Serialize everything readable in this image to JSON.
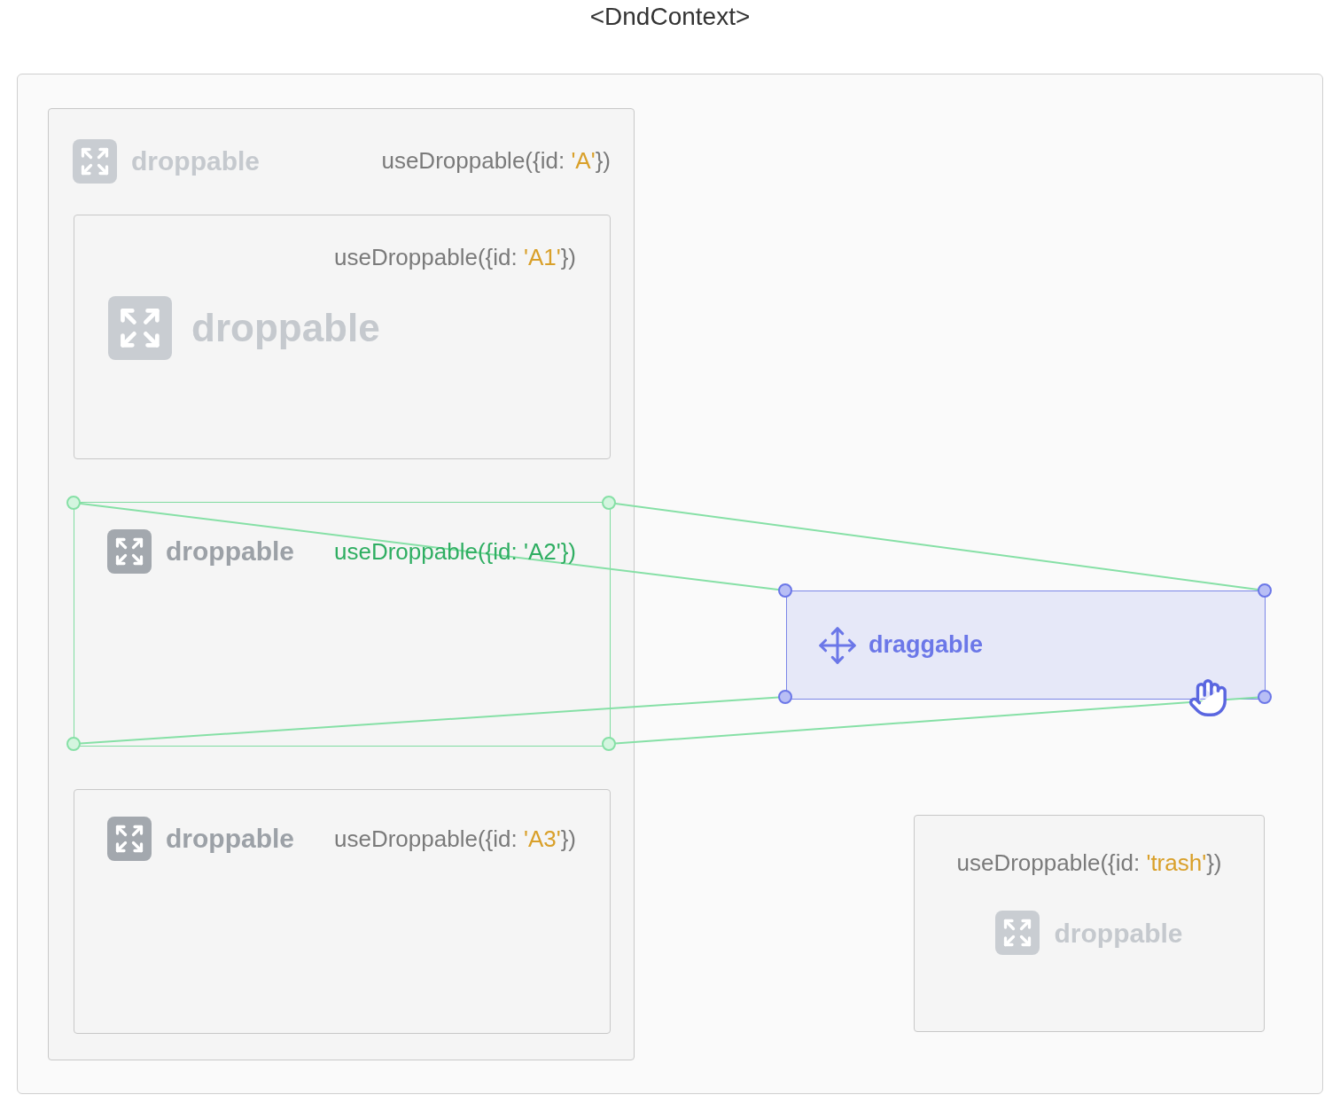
{
  "title": "<DndContext>",
  "droppable": {
    "label": "droppable",
    "code_prefix": "useDroppable({id: ",
    "id": "'A'",
    "code_suffix": "})",
    "faded": true,
    "over": false,
    "children": [
      {
        "label": "droppable",
        "code_prefix": "useDroppable({id: ",
        "id": "'A1'",
        "code_suffix": "})",
        "faded": true,
        "over": false
      },
      {
        "label": "droppable",
        "code_prefix": "useDroppable({id: ",
        "id": "'A2'",
        "code_suffix": "})",
        "faded": false,
        "over": true
      },
      {
        "label": "droppable",
        "code_prefix": "useDroppable({id: ",
        "id": "'A3'",
        "code_suffix": "})",
        "faded": false,
        "over": false
      }
    ]
  },
  "trash": {
    "label": "droppable",
    "code_prefix": "useDroppable({id: ",
    "id": "'trash'",
    "code_suffix": "})",
    "faded": true,
    "over": false
  },
  "draggable": {
    "label": "draggable",
    "dragging": true
  }
}
